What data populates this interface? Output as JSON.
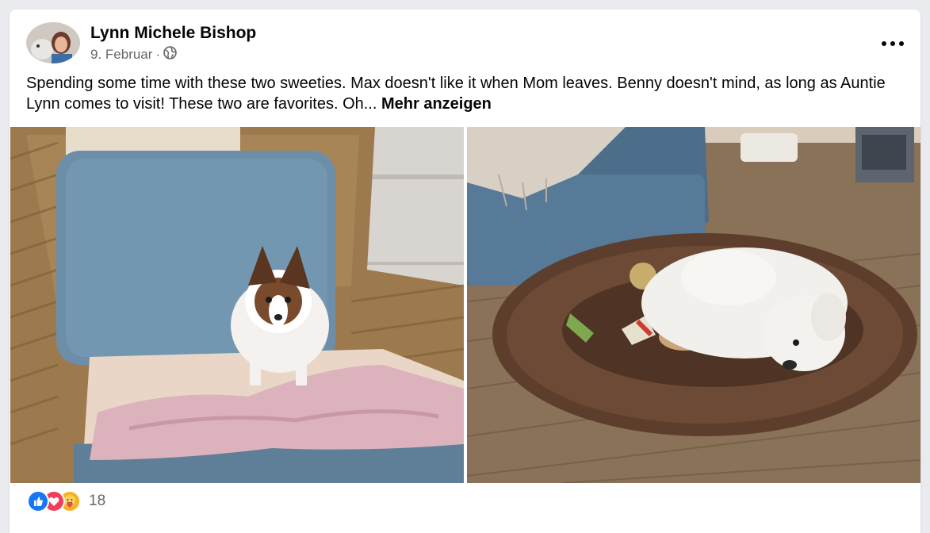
{
  "post": {
    "author_name": "Lynn Michele Bishop",
    "date": "9. Februar",
    "separator": "·",
    "audience_icon": "globe-icon",
    "menu_icon": "more-horizontal-icon",
    "text": "Spending some time with these two sweeties. Max doesn't like it when Mom leaves. Benny doesn't mind, as long as Auntie Lynn comes to visit! These two are favorites.  Oh...",
    "see_more_label": "Mehr anzeigen"
  },
  "photos": [
    {
      "description_icon": "photo-papillon-dog-on-wicker-chair"
    },
    {
      "description_icon": "photo-white-poodle-in-dog-bed"
    }
  ],
  "reactions": {
    "icons": [
      "like-icon",
      "love-icon",
      "care-icon"
    ],
    "count": "18"
  },
  "colors": {
    "text_primary": "#050505",
    "text_secondary": "#65676b",
    "like_blue": "#1877f2",
    "love_red": "#f33e58",
    "care_yellow": "#f7b125"
  }
}
